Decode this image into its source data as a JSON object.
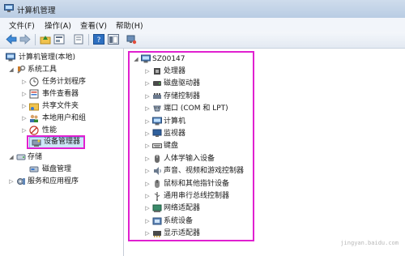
{
  "window": {
    "title": "计算机管理"
  },
  "menu": {
    "items": [
      "文件(F)",
      "操作(A)",
      "查看(V)",
      "帮助(H)"
    ]
  },
  "toolbar": {
    "icons": [
      "back-icon",
      "forward-icon",
      "up-icon",
      "properties-icon",
      "export-icon",
      "help-icon",
      "console-icon",
      "device-action-icon"
    ]
  },
  "left_tree": {
    "root": "计算机管理(本地)",
    "system_tools": "系统工具",
    "task_scheduler": "任务计划程序",
    "event_viewer": "事件查看器",
    "shared_folders": "共享文件夹",
    "local_users": "本地用户和组",
    "performance": "性能",
    "device_manager": "设备管理器",
    "storage": "存储",
    "disk_management": "磁盘管理",
    "services": "服务和应用程序"
  },
  "device_tree": {
    "computer_name": "SZ00147",
    "categories": [
      {
        "label": "处理器",
        "icon": "cpu-icon"
      },
      {
        "label": "磁盘驱动器",
        "icon": "disk-drive-icon"
      },
      {
        "label": "存储控制器",
        "icon": "storage-controller-icon"
      },
      {
        "label": "端口 (COM 和 LPT)",
        "icon": "port-icon"
      },
      {
        "label": "计算机",
        "icon": "computer-icon"
      },
      {
        "label": "监视器",
        "icon": "monitor-icon"
      },
      {
        "label": "键盘",
        "icon": "keyboard-icon"
      },
      {
        "label": "人体学输入设备",
        "icon": "hid-icon"
      },
      {
        "label": "声音、视频和游戏控制器",
        "icon": "sound-icon"
      },
      {
        "label": "鼠标和其他指针设备",
        "icon": "mouse-icon"
      },
      {
        "label": "通用串行总线控制器",
        "icon": "usb-icon"
      },
      {
        "label": "网络适配器",
        "icon": "network-adapter-icon"
      },
      {
        "label": "系统设备",
        "icon": "system-device-icon"
      },
      {
        "label": "显示适配器",
        "icon": "display-adapter-icon"
      }
    ]
  },
  "watermark": {
    "text": "jingyan.baidu.com"
  }
}
